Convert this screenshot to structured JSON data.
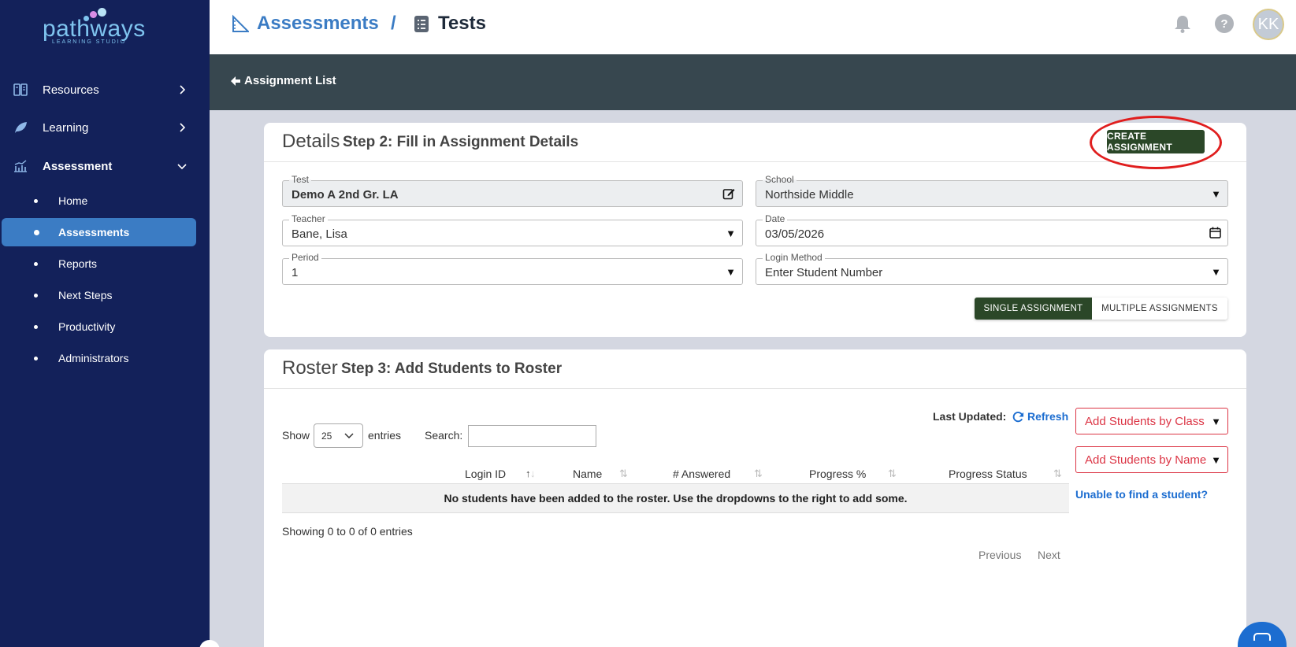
{
  "brand": {
    "name": "pathways",
    "tagline": "LEARNING STUDIO"
  },
  "sidebar": {
    "items": [
      {
        "label": "Resources",
        "icon": "book-icon",
        "expanded": false
      },
      {
        "label": "Learning",
        "icon": "leaf-icon",
        "expanded": false
      },
      {
        "label": "Assessment",
        "icon": "chart-icon",
        "expanded": true
      }
    ],
    "sub_items": [
      {
        "label": "Home"
      },
      {
        "label": "Assessments",
        "active": true
      },
      {
        "label": "Reports"
      },
      {
        "label": "Next Steps"
      },
      {
        "label": "Productivity"
      },
      {
        "label": "Administrators"
      }
    ]
  },
  "header": {
    "crumb1": "Assessments",
    "separator": "/",
    "crumb2": "Tests",
    "avatar_initials": "KK",
    "help": "?"
  },
  "subheader": {
    "back_label": "Assignment List"
  },
  "details": {
    "title": "Details",
    "step": "Step 2: Fill in Assignment Details",
    "create_button": "CREATE ASSIGNMENT",
    "fields": {
      "test": {
        "label": "Test",
        "value": "Demo A 2nd Gr. LA"
      },
      "school": {
        "label": "School",
        "value": "Northside Middle"
      },
      "teacher": {
        "label": "Teacher",
        "value": "Bane, Lisa"
      },
      "date": {
        "label": "Date",
        "value": "03/05/2026"
      },
      "period": {
        "label": "Period",
        "value": "1"
      },
      "login_method": {
        "label": "Login Method",
        "value": "Enter Student Number"
      }
    },
    "mode_single": "SINGLE ASSIGNMENT",
    "mode_multiple": "MULTIPLE ASSIGNMENTS"
  },
  "roster": {
    "title": "Roster",
    "step": "Step 3: Add Students to Roster",
    "show_label": "Show",
    "entries_value": "25",
    "entries_label": "entries",
    "search_label": "Search:",
    "last_updated_label": "Last Updated:",
    "refresh_label": "Refresh",
    "columns": [
      "Login ID",
      "Name",
      "# Answered",
      "Progress %",
      "Progress Status"
    ],
    "empty_message": "No students have been added to the roster. Use the dropdowns to the right to add some.",
    "showing": "Showing 0 to 0 of 0 entries",
    "previous": "Previous",
    "next": "Next",
    "add_by_class": "Add Students by Class",
    "add_by_name": "Add Students by Name",
    "unable_link": "Unable to find a student?"
  },
  "colors": {
    "sidebar_bg": "#13215a",
    "active_item": "#3b7cc4",
    "primary_button": "#2b4728",
    "subheader_bg": "#37474f",
    "link_blue": "#1c6dd0",
    "danger_red": "#dc3545",
    "highlight": "#e01e1e"
  }
}
